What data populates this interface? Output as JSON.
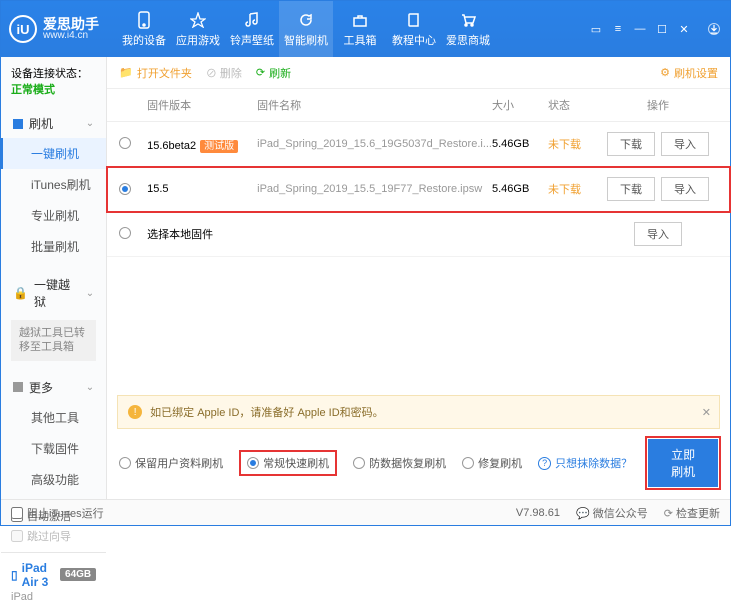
{
  "brand": {
    "name": "爱思助手",
    "url": "www.i4.cn",
    "logo_letter": "iU"
  },
  "nav": [
    {
      "label": "我的设备"
    },
    {
      "label": "应用游戏"
    },
    {
      "label": "铃声壁纸"
    },
    {
      "label": "智能刷机",
      "active": true
    },
    {
      "label": "工具箱"
    },
    {
      "label": "教程中心"
    },
    {
      "label": "爱思商城"
    }
  ],
  "connection": {
    "prefix": "设备连接状态：",
    "status": "正常模式"
  },
  "side": {
    "flash_head": "刷机",
    "flash_items": [
      "一键刷机",
      "iTunes刷机",
      "专业刷机",
      "批量刷机"
    ],
    "jail_head": "一键越狱",
    "jail_note": "越狱工具已转移至工具箱",
    "more_head": "更多",
    "more_items": [
      "其他工具",
      "下载固件",
      "高级功能"
    ],
    "auto_activate": "自动激活",
    "skip_guide": "跳过向导",
    "device_name": "iPad Air 3",
    "device_storage": "64GB",
    "device_type": "iPad"
  },
  "toolbar": {
    "open_folder": "打开文件夹",
    "delete": "删除",
    "refresh": "刷新",
    "settings": "刷机设置"
  },
  "columns": {
    "ver": "固件版本",
    "name": "固件名称",
    "size": "大小",
    "status": "状态",
    "ops": "操作"
  },
  "rows": [
    {
      "ver": "15.6beta2",
      "beta": "测试版",
      "name": "iPad_Spring_2019_15.6_19G5037d_Restore.i...",
      "size": "5.46GB",
      "status": "未下载",
      "selected": false
    },
    {
      "ver": "15.5",
      "beta": "",
      "name": "iPad_Spring_2019_15.5_19F77_Restore.ipsw",
      "size": "5.46GB",
      "status": "未下载",
      "selected": true
    }
  ],
  "local_firmware": "选择本地固件",
  "btn": {
    "download": "下载",
    "import": "导入"
  },
  "notice": "如已绑定 Apple ID，请准备好 Apple ID和密码。",
  "modes": {
    "keep_data": "保留用户资料刷机",
    "normal_fast": "常规快速刷机",
    "anti_recovery": "防数据恢复刷机",
    "repair": "修复刷机",
    "clear_only": "只想抹除数据？",
    "flash_now": "立即刷机"
  },
  "status": {
    "block_itunes": "阻止iTunes运行",
    "version": "V7.98.61",
    "wechat": "微信公众号",
    "check_update": "检查更新"
  }
}
